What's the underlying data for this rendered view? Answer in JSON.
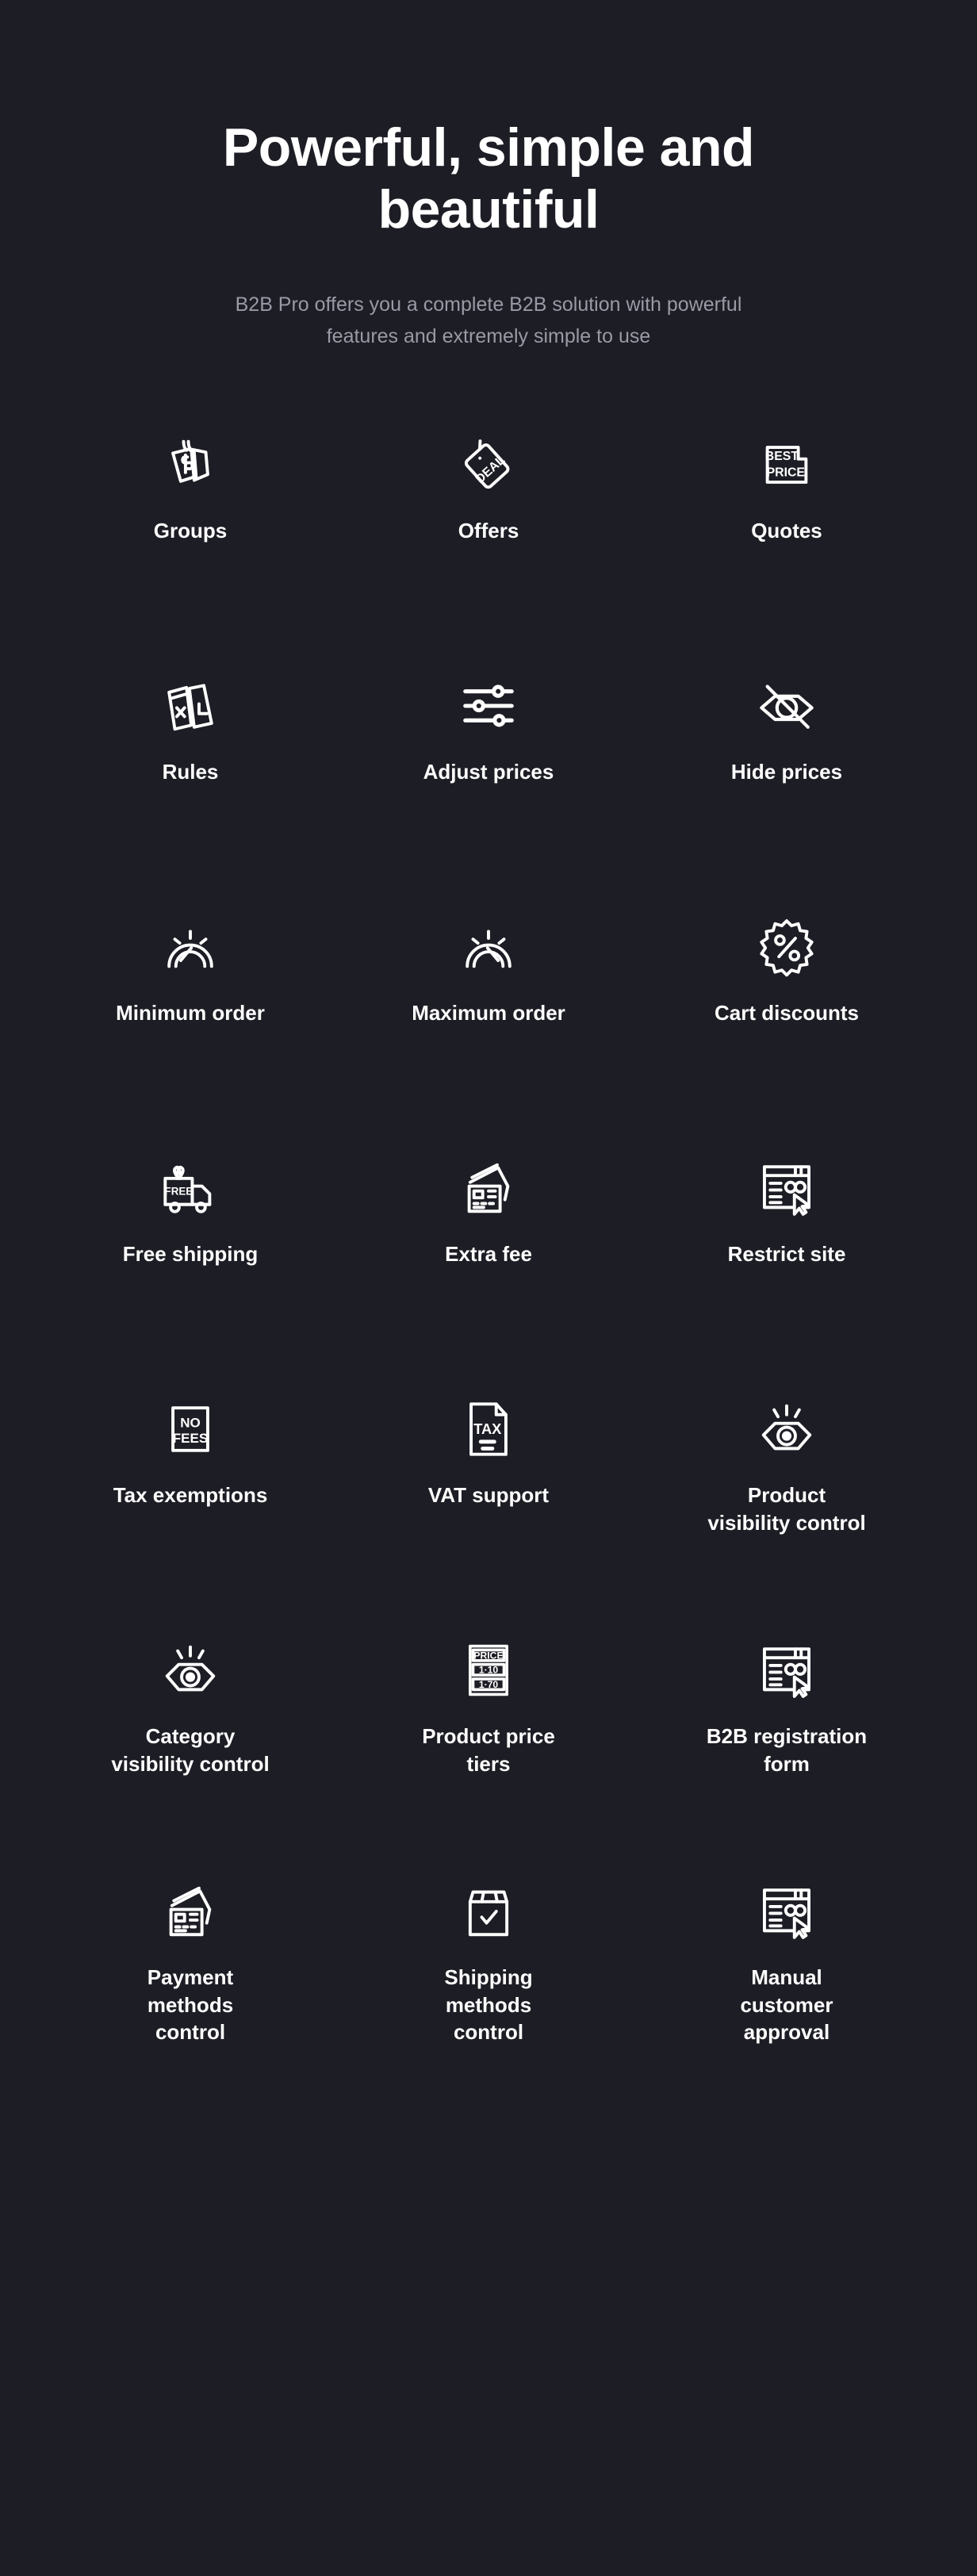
{
  "hero": {
    "title": "Powerful, simple and beautiful",
    "subtitle": "B2B Pro offers you a complete B2B solution with powerful features and extremely simple to use"
  },
  "colors": {
    "background": "#1d1d25",
    "title": "#ffffff",
    "subtitle": "#9a9aa6",
    "icon_stroke": "#ffffff",
    "label": "#ffffff"
  },
  "features": [
    {
      "label": "Groups",
      "icon": "price-tags-dollar-icon",
      "icon_text": "$"
    },
    {
      "label": "Offers",
      "icon": "deal-tag-icon",
      "icon_text": "DEAL"
    },
    {
      "label": "Quotes",
      "icon": "best-price-badge-icon",
      "icon_text": "BEST PRICE"
    },
    {
      "label": "Rules",
      "icon": "rule-cards-check-cross-icon",
      "icon_text": ""
    },
    {
      "label": "Adjust prices",
      "icon": "sliders-icon",
      "icon_text": ""
    },
    {
      "label": "Hide prices",
      "icon": "eye-off-icon",
      "icon_text": ""
    },
    {
      "label": "Minimum order",
      "icon": "gauge-min-icon",
      "icon_text": ""
    },
    {
      "label": "Maximum order",
      "icon": "gauge-max-icon",
      "icon_text": ""
    },
    {
      "label": "Cart discounts",
      "icon": "percent-starburst-icon",
      "icon_text": "%"
    },
    {
      "label": "Free shipping",
      "icon": "free-delivery-truck-icon",
      "icon_text": "FREE"
    },
    {
      "label": "Extra fee",
      "icon": "credit-cards-icon",
      "icon_text": ""
    },
    {
      "label": "Restrict site",
      "icon": "browser-cursor-icon",
      "icon_text": ""
    },
    {
      "label": "Tax exemptions",
      "icon": "no-fees-badge-icon",
      "icon_text": "NO FEES"
    },
    {
      "label": "VAT support",
      "icon": "tax-document-icon",
      "icon_text": "TAX"
    },
    {
      "label": "Product\nvisibility control",
      "icon": "eye-rays-icon",
      "icon_text": ""
    },
    {
      "label": "Category\nvisibility control",
      "icon": "eye-rays-icon",
      "icon_text": ""
    },
    {
      "label": "Product price\ntiers",
      "icon": "price-tiers-board-icon",
      "icon_text": "PRICE 1·10 1·70"
    },
    {
      "label": "B2B registration\nform",
      "icon": "browser-cursor-icon",
      "icon_text": ""
    },
    {
      "label": "Payment\nmethods\ncontrol",
      "icon": "credit-cards-icon",
      "icon_text": ""
    },
    {
      "label": "Shipping\nmethods\ncontrol",
      "icon": "box-check-icon",
      "icon_text": ""
    },
    {
      "label": "Manual\ncustomer\napproval",
      "icon": "browser-cursor-icon",
      "icon_text": ""
    }
  ],
  "icon_labels": {
    "deal": "DEAL",
    "best": "BEST",
    "price": "PRICE",
    "free": "FREE",
    "no": "NO",
    "fees": "FEES",
    "tax": "TAX",
    "tier_price": "PRICE",
    "tier_1": "1·10",
    "tier_2": "1·70"
  }
}
